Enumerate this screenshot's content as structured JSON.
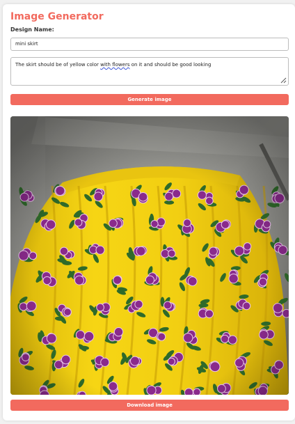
{
  "header": {
    "title": "Image Generator"
  },
  "form": {
    "design_name_label": "Design Name:",
    "design_name_value": "mini skirt",
    "description": {
      "before": "The skirt should be of yellow color ",
      "misspelled": "with  flowers",
      "after": "  on it and should be good looking"
    },
    "generate_label": "Generate image"
  },
  "result": {
    "image_subject": "yellow skirt with purple flowers",
    "download_label": "Download image"
  },
  "colors": {
    "accent": "#f26a5e",
    "fabric": "#f2cf12",
    "flower": "#8a2a8c",
    "leaf": "#2f6a2a"
  }
}
